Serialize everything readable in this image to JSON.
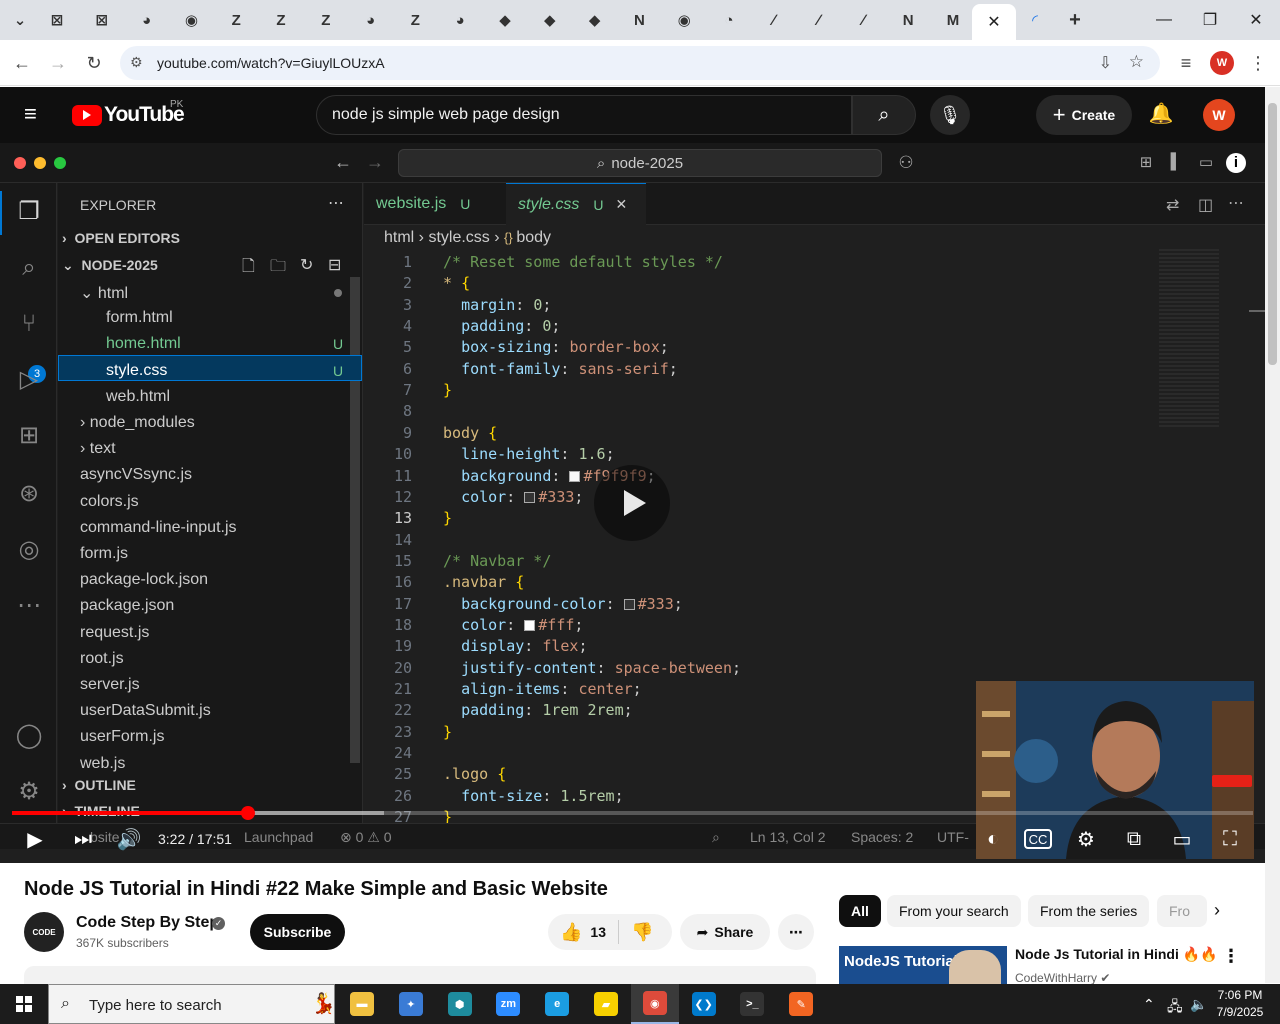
{
  "browser": {
    "url": "youtube.com/watch?v=GiuylLOUzxA",
    "profile_initial": "W",
    "tab_icons": [
      "⊠",
      "⊠",
      "◕",
      "◉",
      "Z",
      "Z",
      "Z",
      "◕",
      "Z",
      "◕",
      "◆",
      "◆",
      "◆",
      "N",
      "◉",
      "◔",
      "∕",
      "∕",
      "∕",
      "N",
      "M"
    ],
    "active_tab_close": "✕",
    "new_tab": "+"
  },
  "youtube": {
    "logo_text": "YouTube",
    "country_code": "PK",
    "search_query": "node js simple web page design",
    "create_label": "Create",
    "avatar_initial": "W"
  },
  "vscode": {
    "command_center": "node-2025",
    "explorer_title": "EXPLORER",
    "open_editors": "OPEN EDITORS",
    "project": "NODE-2025",
    "outline": "OUTLINE",
    "timeline": "TIMELINE",
    "git_badge": "3",
    "tree": [
      {
        "name": "html",
        "indent": 1,
        "kind": "folder-open",
        "status": "dot"
      },
      {
        "name": "form.html",
        "indent": 2,
        "kind": "file",
        "status": ""
      },
      {
        "name": "home.html",
        "indent": 2,
        "kind": "file",
        "status": "U"
      },
      {
        "name": "style.css",
        "indent": 2,
        "kind": "file",
        "status": "U",
        "selected": true
      },
      {
        "name": "web.html",
        "indent": 2,
        "kind": "file",
        "status": ""
      },
      {
        "name": "node_modules",
        "indent": 1,
        "kind": "folder",
        "status": ""
      },
      {
        "name": "text",
        "indent": 1,
        "kind": "folder",
        "status": ""
      },
      {
        "name": "asyncVSsync.js",
        "indent": 1,
        "kind": "file",
        "status": ""
      },
      {
        "name": "colors.js",
        "indent": 1,
        "kind": "file",
        "status": ""
      },
      {
        "name": "command-line-input.js",
        "indent": 1,
        "kind": "file",
        "status": ""
      },
      {
        "name": "form.js",
        "indent": 1,
        "kind": "file",
        "status": ""
      },
      {
        "name": "package-lock.json",
        "indent": 1,
        "kind": "file",
        "status": ""
      },
      {
        "name": "package.json",
        "indent": 1,
        "kind": "file",
        "status": ""
      },
      {
        "name": "request.js",
        "indent": 1,
        "kind": "file",
        "status": ""
      },
      {
        "name": "root.js",
        "indent": 1,
        "kind": "file",
        "status": ""
      },
      {
        "name": "server.js",
        "indent": 1,
        "kind": "file",
        "status": ""
      },
      {
        "name": "userDataSubmit.js",
        "indent": 1,
        "kind": "file",
        "status": ""
      },
      {
        "name": "userForm.js",
        "indent": 1,
        "kind": "file",
        "status": ""
      },
      {
        "name": "web.js",
        "indent": 1,
        "kind": "file",
        "status": ""
      }
    ],
    "tabs": [
      {
        "label": "website.js",
        "status": "U",
        "active": false
      },
      {
        "label": "style.css",
        "status": "U",
        "active": true
      }
    ],
    "breadcrumb": [
      "html",
      "style.css",
      "body"
    ],
    "current_line": 13,
    "code": [
      [
        [
          "c-com",
          "/* Reset some default styles */"
        ]
      ],
      [
        [
          "c-sel",
          "* "
        ],
        [
          "c-brace",
          "{"
        ]
      ],
      [
        [
          "",
          "  "
        ],
        [
          "c-prop",
          "margin"
        ],
        [
          "",
          ": "
        ],
        [
          "c-num",
          "0"
        ],
        [
          "",
          ";"
        ]
      ],
      [
        [
          "",
          "  "
        ],
        [
          "c-prop",
          "padding"
        ],
        [
          "",
          ": "
        ],
        [
          "c-num",
          "0"
        ],
        [
          "",
          ";"
        ]
      ],
      [
        [
          "",
          "  "
        ],
        [
          "c-prop",
          "box-sizing"
        ],
        [
          "",
          ": "
        ],
        [
          "c-val",
          "border-box"
        ],
        [
          "",
          ";"
        ]
      ],
      [
        [
          "",
          "  "
        ],
        [
          "c-prop",
          "font-family"
        ],
        [
          "",
          ": "
        ],
        [
          "c-val",
          "sans-serif"
        ],
        [
          "",
          ";"
        ]
      ],
      [
        [
          "c-brace",
          "}"
        ]
      ],
      [
        [
          "",
          ""
        ]
      ],
      [
        [
          "c-sel",
          "body "
        ],
        [
          "c-brace",
          "{"
        ]
      ],
      [
        [
          "",
          "  "
        ],
        [
          "c-prop",
          "line-height"
        ],
        [
          "",
          ": "
        ],
        [
          "c-num",
          "1.6"
        ],
        [
          "",
          ";"
        ]
      ],
      [
        [
          "",
          "  "
        ],
        [
          "c-prop",
          "background"
        ],
        [
          "",
          ": "
        ],
        [
          "sw:#f9f9f9",
          ""
        ],
        [
          "c-val",
          "#f9f9f9"
        ],
        [
          "",
          ";"
        ]
      ],
      [
        [
          "",
          "  "
        ],
        [
          "c-prop",
          "color"
        ],
        [
          "",
          ": "
        ],
        [
          "sw:#333333",
          ""
        ],
        [
          "c-val",
          "#333"
        ],
        [
          "",
          ";"
        ]
      ],
      [
        [
          "c-brace",
          "}"
        ]
      ],
      [
        [
          "",
          ""
        ]
      ],
      [
        [
          "c-com",
          "/* Navbar */"
        ]
      ],
      [
        [
          "c-sel",
          ".navbar "
        ],
        [
          "c-brace",
          "{"
        ]
      ],
      [
        [
          "",
          "  "
        ],
        [
          "c-prop",
          "background-color"
        ],
        [
          "",
          ": "
        ],
        [
          "sw:#333333",
          ""
        ],
        [
          "c-val",
          "#333"
        ],
        [
          "",
          ";"
        ]
      ],
      [
        [
          "",
          "  "
        ],
        [
          "c-prop",
          "color"
        ],
        [
          "",
          ": "
        ],
        [
          "sw:#ffffff",
          ""
        ],
        [
          "c-val",
          "#fff"
        ],
        [
          "",
          ";"
        ]
      ],
      [
        [
          "",
          "  "
        ],
        [
          "c-prop",
          "display"
        ],
        [
          "",
          ": "
        ],
        [
          "c-val",
          "flex"
        ],
        [
          "",
          ";"
        ]
      ],
      [
        [
          "",
          "  "
        ],
        [
          "c-prop",
          "justify-content"
        ],
        [
          "",
          ": "
        ],
        [
          "c-val",
          "space-between"
        ],
        [
          "",
          ";"
        ]
      ],
      [
        [
          "",
          "  "
        ],
        [
          "c-prop",
          "align-items"
        ],
        [
          "",
          ": "
        ],
        [
          "c-val",
          "center"
        ],
        [
          "",
          ";"
        ]
      ],
      [
        [
          "",
          "  "
        ],
        [
          "c-prop",
          "padding"
        ],
        [
          "",
          ": "
        ],
        [
          "c-num",
          "1rem 2rem"
        ],
        [
          "",
          ";"
        ]
      ],
      [
        [
          "c-brace",
          "}"
        ]
      ],
      [
        [
          "",
          ""
        ]
      ],
      [
        [
          "c-sel",
          ".logo "
        ],
        [
          "c-brace",
          "{"
        ]
      ],
      [
        [
          "",
          "  "
        ],
        [
          "c-prop",
          "font-size"
        ],
        [
          "",
          ": "
        ],
        [
          "c-num",
          "1.5rem"
        ],
        [
          "",
          ";"
        ]
      ],
      [
        [
          "c-brace",
          "}"
        ]
      ]
    ],
    "status_bar": {
      "left": "bsite",
      "launchpad": "Launchpad",
      "problems": "⊗ 0 ⚠ 0",
      "position": "Ln 13, Col 2",
      "spaces": "Spaces: 2",
      "encoding": "UTF-"
    }
  },
  "player": {
    "time": "3:22 / 17:51",
    "progress": 0.19,
    "buffered": 0.3
  },
  "video": {
    "title": "Node JS Tutorial in Hindi #22 Make Simple and Basic Website",
    "channel": "Code Step By Step",
    "channel_avatar_text": "CODE",
    "subscribers": "367K subscribers",
    "subscribe_label": "Subscribe",
    "likes": "13",
    "share_label": "Share"
  },
  "chips": [
    "All",
    "From your search",
    "From the series",
    "Fro"
  ],
  "recommendation": {
    "thumb_text": "NodeJS Tutorial in",
    "title": "Node Js Tutorial in Hindi 🔥🔥",
    "channel": "CodeWithHarry"
  },
  "taskbar": {
    "search_placeholder": "Type here to search",
    "time": "7:06 PM",
    "date": "7/9/2025",
    "apps": [
      {
        "name": "file-explorer",
        "color": "#f0c040",
        "glyph": "▬"
      },
      {
        "name": "app-blue",
        "color": "#3a7bd5",
        "glyph": "✦"
      },
      {
        "name": "app-teal",
        "color": "#1e8c9e",
        "glyph": "⬢"
      },
      {
        "name": "zoom",
        "color": "#2d8cff",
        "glyph": "zm"
      },
      {
        "name": "edge",
        "color": "#1b9de2",
        "glyph": "e"
      },
      {
        "name": "sticky-notes",
        "color": "#f7d000",
        "glyph": "▰"
      },
      {
        "name": "chrome",
        "color": "#de4b3b",
        "glyph": "◉"
      },
      {
        "name": "vscode",
        "color": "#007acc",
        "glyph": "❮❯"
      },
      {
        "name": "terminal",
        "color": "#333333",
        "glyph": ">_"
      },
      {
        "name": "app-orange",
        "color": "#f26522",
        "glyph": "✎"
      }
    ]
  }
}
